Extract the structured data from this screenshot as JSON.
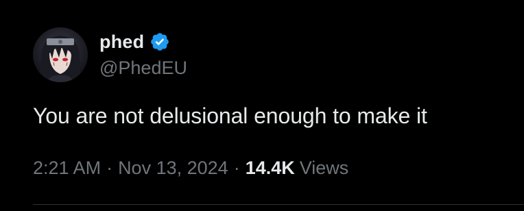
{
  "author": {
    "display_name": "phed",
    "handle": "@PhedEU",
    "verified": true,
    "avatar_icon": "anime-character-avatar"
  },
  "tweet": {
    "text": "You are not delusional enough to make it",
    "time": "2:21 AM",
    "date": "Nov 13, 2024",
    "separator": "·",
    "views_count": "14.4K",
    "views_label": "Views"
  },
  "colors": {
    "background": "#000000",
    "primary_text": "#e7e9ea",
    "secondary_text": "#71767b",
    "verified_badge": "#1d9bf0",
    "divider": "#2f3336"
  }
}
